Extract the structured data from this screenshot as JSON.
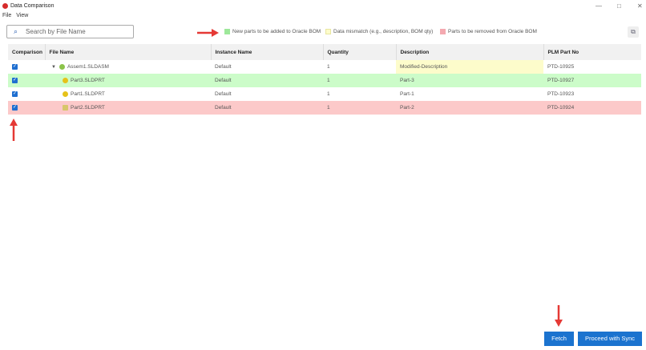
{
  "window": {
    "title": "Data Comparison",
    "menu": [
      "File",
      "View"
    ]
  },
  "search": {
    "placeholder": "Search by File Name"
  },
  "legend": [
    {
      "label": "New parts to be added to Oracle BOM",
      "color": "#9de89a"
    },
    {
      "label": "Data mismatch (e.g., description, BOM qty)",
      "color": "#fdfccb"
    },
    {
      "label": "Parts to be removed from Oracle BOM",
      "color": "#f4a9b0"
    }
  ],
  "table": {
    "headers": [
      "Comparison",
      "File Name",
      "Instance Name",
      "Quantity",
      "Description",
      "PLM Part No"
    ],
    "rows": [
      {
        "file": "Assem1.SLDASM",
        "instance": "Default",
        "qty": "1",
        "desc": "Modified-Description",
        "plm": "PTD-10925"
      },
      {
        "file": "Part3.SLDPRT",
        "instance": "Default",
        "qty": "1",
        "desc": "Part-3",
        "plm": "PTD-10927"
      },
      {
        "file": "Part1.SLDPRT",
        "instance": "Default",
        "qty": "1",
        "desc": "Part-1",
        "plm": "PTD-10923"
      },
      {
        "file": "Part2.SLDPRT",
        "instance": "Default",
        "qty": "1",
        "desc": "Part-2",
        "plm": "PTD-10924"
      }
    ]
  },
  "buttons": {
    "fetch": "Fetch",
    "sync": "Proceed with Sync"
  }
}
